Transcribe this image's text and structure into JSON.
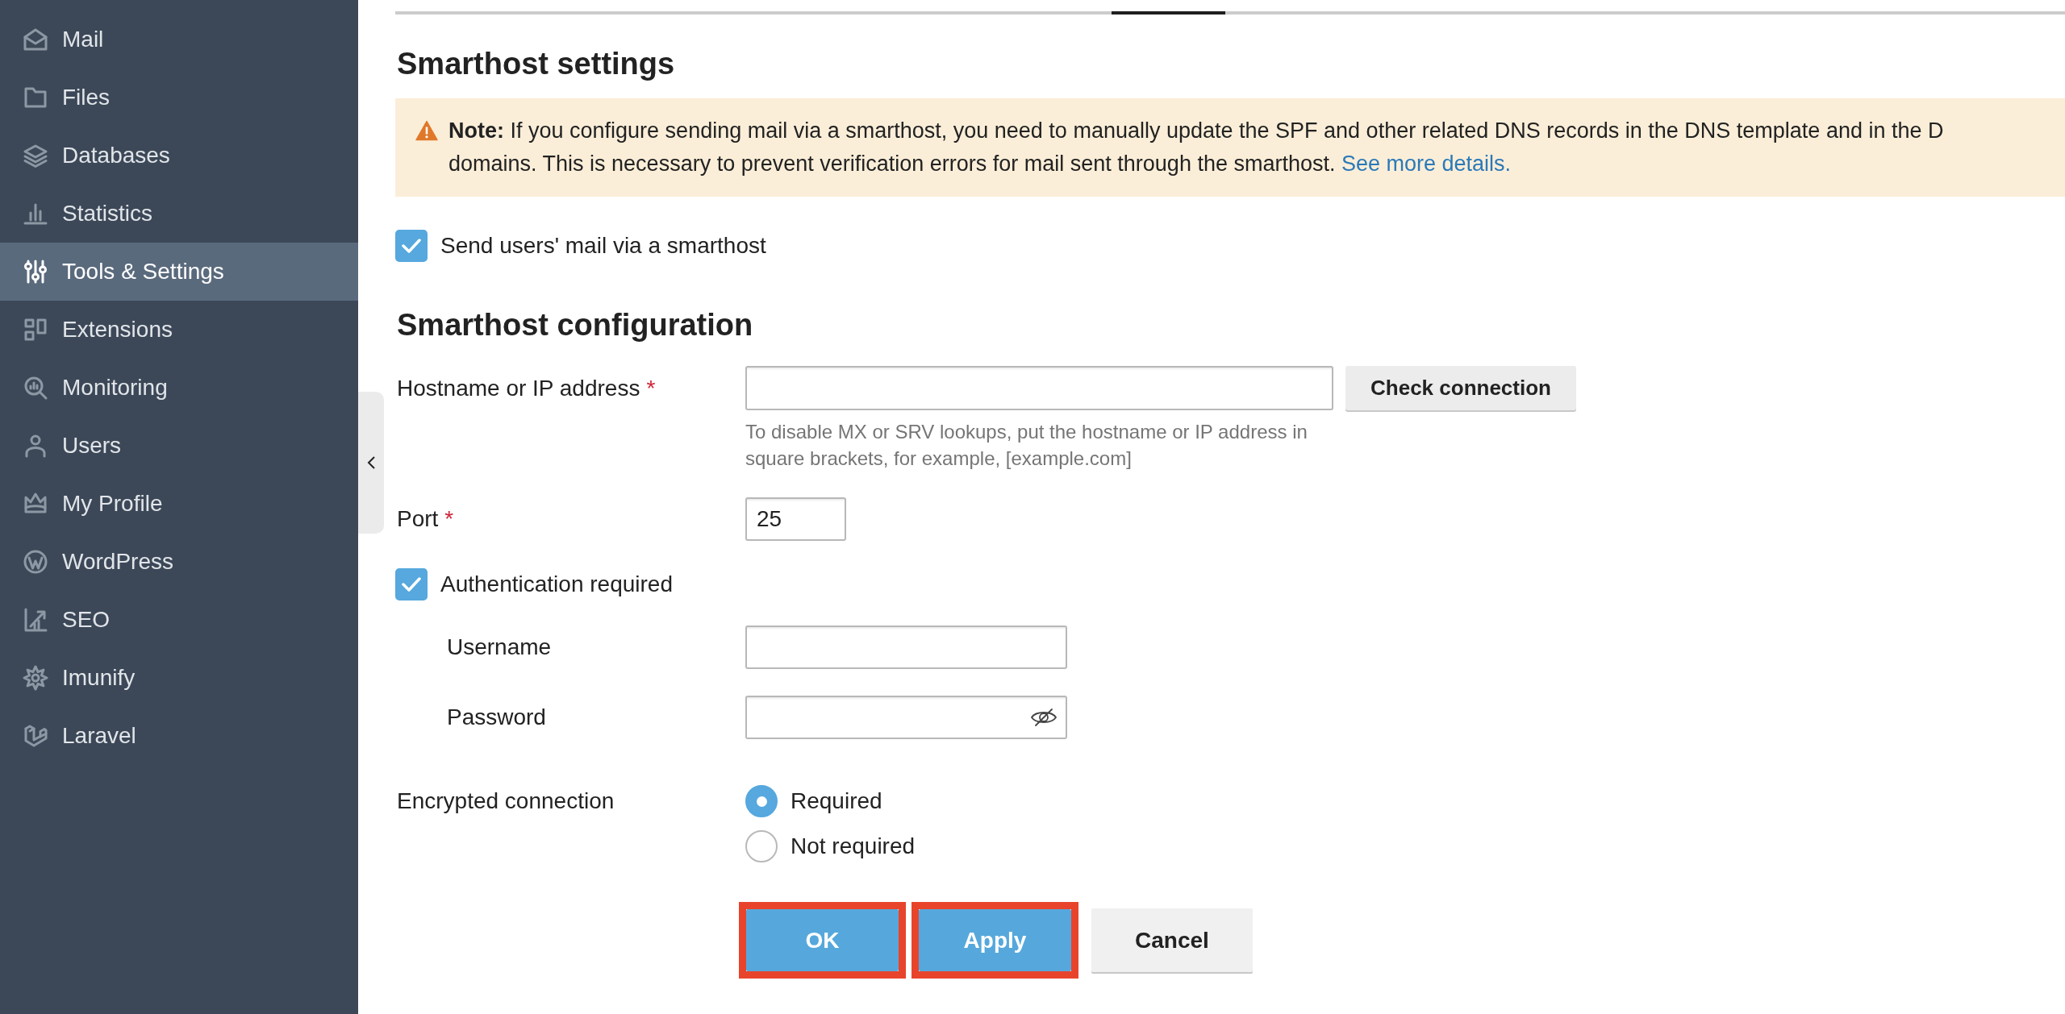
{
  "tabs": [
    {
      "selected": false
    },
    {
      "selected": true
    },
    {
      "selected": false
    }
  ],
  "sidebar": {
    "items": [
      {
        "label": "Mail",
        "selected": false
      },
      {
        "label": "Files",
        "selected": false
      },
      {
        "label": "Databases",
        "selected": false
      },
      {
        "label": "Statistics",
        "selected": false
      },
      {
        "label": "Tools & Settings",
        "selected": true
      },
      {
        "label": "Extensions",
        "selected": false
      },
      {
        "label": "Monitoring",
        "selected": false
      },
      {
        "label": "Users",
        "selected": false
      },
      {
        "label": "My Profile",
        "selected": false
      },
      {
        "label": "WordPress",
        "selected": false
      },
      {
        "label": "SEO",
        "selected": false
      },
      {
        "label": "Imunify",
        "selected": false
      },
      {
        "label": "Laravel",
        "selected": false
      }
    ]
  },
  "page_title": "Smarthost settings",
  "note": {
    "lines": [
      "**Note:** If you configure sending mail via a smarthost, you need to manually update the SPF and other related DNS records in the DNS template and in the D",
      "domains. This is necessary to prevent verification errors for mail sent through the smarthost."
    ],
    "link": "See more details."
  },
  "smarthost_checkbox": {
    "label": "Send users' mail via a smarthost",
    "checked": true
  },
  "configuration": {
    "heading": "Smarthost configuration",
    "hostname": {
      "label": "Hostname or IP address",
      "required_mark": "*",
      "hint": "To disable MX or SRV lookups, put the hostname or IP address in square brackets, for example, [example.com]",
      "button": "Check connection"
    },
    "port": {
      "label": "Port",
      "required_mark": "*",
      "value": "25"
    },
    "authentication": {
      "label": "Authentication required",
      "checked": true
    },
    "username": {
      "label": "Username"
    },
    "password": {
      "label": "Password"
    },
    "encrypted_connection": {
      "label": "Encrypted connection",
      "options": [
        {
          "label": "Required",
          "selected": true
        },
        {
          "label": "Not required",
          "selected": false
        }
      ]
    }
  },
  "buttons": [
    {
      "label": "OK",
      "kind": "primary",
      "highlighted": true
    },
    {
      "label": "Apply",
      "kind": "primary",
      "highlighted": true
    },
    {
      "label": "Cancel",
      "kind": "secondary",
      "highlighted": false
    }
  ]
}
